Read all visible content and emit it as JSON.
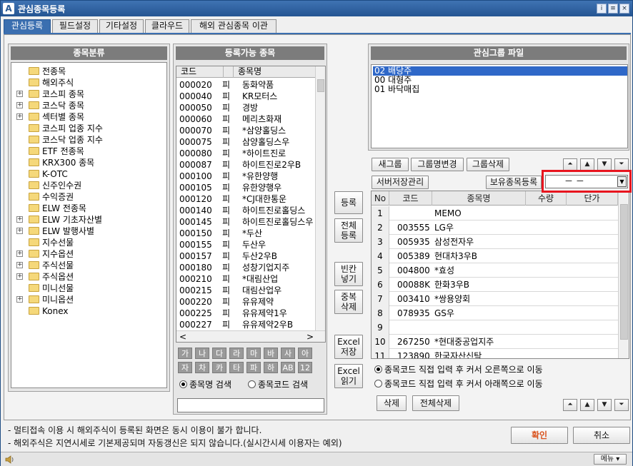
{
  "window": {
    "title": "관심종목등록",
    "logo": "A",
    "buttons": [
      "i",
      "≡",
      "×"
    ]
  },
  "tabs": [
    "관심등록",
    "필드설정",
    "기타설정",
    "클라우드",
    "해외 관심종목 이관"
  ],
  "left_panel": {
    "title": "종목분류",
    "tree": [
      {
        "label": "전종목",
        "expandable": false
      },
      {
        "label": "해외주식",
        "expandable": false
      },
      {
        "label": "코스피 종목",
        "expandable": true
      },
      {
        "label": "코스닥 종목",
        "expandable": true
      },
      {
        "label": "섹터별 종목",
        "expandable": true
      },
      {
        "label": "코스피 업종 지수",
        "expandable": false
      },
      {
        "label": "코스닥 업종 지수",
        "expandable": false
      },
      {
        "label": "ETF 전종목",
        "expandable": false
      },
      {
        "label": "KRX300 종목",
        "expandable": false
      },
      {
        "label": "K-OTC",
        "expandable": false
      },
      {
        "label": "신주인수권",
        "expandable": false
      },
      {
        "label": "수익증권",
        "expandable": false
      },
      {
        "label": "ELW 전종목",
        "expandable": false
      },
      {
        "label": "ELW 기초자산별",
        "expandable": true
      },
      {
        "label": "ELW 발행사별",
        "expandable": true
      },
      {
        "label": "지수선물",
        "expandable": false
      },
      {
        "label": "지수옵션",
        "expandable": true
      },
      {
        "label": "주식선물",
        "expandable": true
      },
      {
        "label": "주식옵션",
        "expandable": true
      },
      {
        "label": "미니선물",
        "expandable": false
      },
      {
        "label": "미니옵션",
        "expandable": true
      },
      {
        "label": "Konex",
        "expandable": false
      }
    ]
  },
  "middle_panel": {
    "title": "등록가능 종목",
    "columns": [
      "코드",
      "종목명"
    ],
    "rows": [
      {
        "code": "000020",
        "mk": "피",
        "name": "동화약품"
      },
      {
        "code": "000040",
        "mk": "피",
        "name": "KR모터스"
      },
      {
        "code": "000050",
        "mk": "피",
        "name": "경방"
      },
      {
        "code": "000060",
        "mk": "피",
        "name": "메리츠화재"
      },
      {
        "code": "000070",
        "mk": "피",
        "name": "*삼양홀딩스"
      },
      {
        "code": "000075",
        "mk": "피",
        "name": "삼양홀딩스우"
      },
      {
        "code": "000080",
        "mk": "피",
        "name": "*하이트진로"
      },
      {
        "code": "000087",
        "mk": "피",
        "name": "하이트진로2우B"
      },
      {
        "code": "000100",
        "mk": "피",
        "name": "*유한양행"
      },
      {
        "code": "000105",
        "mk": "피",
        "name": "유한양행우"
      },
      {
        "code": "000120",
        "mk": "피",
        "name": "*CJ대한통운"
      },
      {
        "code": "000140",
        "mk": "피",
        "name": "하이트진로홀딩스"
      },
      {
        "code": "000145",
        "mk": "피",
        "name": "하이트진로홀딩스우"
      },
      {
        "code": "000150",
        "mk": "피",
        "name": "*두산"
      },
      {
        "code": "000155",
        "mk": "피",
        "name": "두산우"
      },
      {
        "code": "000157",
        "mk": "피",
        "name": "두산2우B"
      },
      {
        "code": "000180",
        "mk": "피",
        "name": "성창기업지주"
      },
      {
        "code": "000210",
        "mk": "피",
        "name": "*대림산업"
      },
      {
        "code": "000215",
        "mk": "피",
        "name": "대림산업우"
      },
      {
        "code": "000220",
        "mk": "피",
        "name": "유유제약"
      },
      {
        "code": "000225",
        "mk": "피",
        "name": "유유제약1우"
      },
      {
        "code": "000227",
        "mk": "피",
        "name": "유유제약2우B"
      }
    ],
    "scroll_left": "<",
    "scroll_right": ">",
    "keys_row1": [
      "가",
      "나",
      "다",
      "라",
      "마",
      "바",
      "사",
      "아"
    ],
    "keys_row2": [
      "자",
      "차",
      "카",
      "타",
      "파",
      "하",
      "AB",
      "12"
    ],
    "search_by_name": "종목명 검색",
    "search_by_code": "종목코드 검색",
    "search_value": ""
  },
  "center_buttons": {
    "register": "등록",
    "register_all": [
      "전체",
      "등록"
    ],
    "insert_blank": [
      "빈칸",
      "넣기"
    ],
    "delete_dup": [
      "중복",
      "삭제"
    ],
    "excel_save": [
      "Excel",
      "저장"
    ],
    "excel_read": [
      "Excel",
      "읽기"
    ]
  },
  "right_panel": {
    "title": "관심그룹 파일",
    "groups": [
      "02 배당주",
      "00 대형주",
      "01 바닥매집"
    ],
    "new_group": "새그룹",
    "rename_group": "그룹명변경",
    "delete_group": "그룹삭제",
    "server_manage": "서버저장관리",
    "holdings_register": "보유종목등록",
    "holdings_select_value": "－ －",
    "grid_columns": [
      "No",
      "코드",
      "종목명",
      "수량",
      "단가"
    ],
    "grid_rows": [
      {
        "no": "1",
        "code": "",
        "name": "MEMO"
      },
      {
        "no": "2",
        "code": "003555",
        "name": "LG우"
      },
      {
        "no": "3",
        "code": "005935",
        "name": "삼성전자우"
      },
      {
        "no": "4",
        "code": "005389",
        "name": "현대차3우B"
      },
      {
        "no": "5",
        "code": "004800",
        "name": "*효성"
      },
      {
        "no": "6",
        "code": "00088K",
        "name": "한화3우B"
      },
      {
        "no": "7",
        "code": "003410",
        "name": "*쌍용양회"
      },
      {
        "no": "8",
        "code": "078935",
        "name": "GS우"
      },
      {
        "no": "9",
        "code": "",
        "name": ""
      },
      {
        "no": "10",
        "code": "267250",
        "name": "*현대중공업지주"
      },
      {
        "no": "11",
        "code": "123890",
        "name": "한국자산신탁"
      }
    ],
    "radio_right": "종목코드 직접 입력 후 커서 오른쪽으로 이동",
    "radio_down": "종목코드 직접 입력 후 커서 아래쪽으로 이동",
    "delete": "삭제",
    "delete_all": "전체삭제"
  },
  "notes": [
    "- 멀티접속 이용 시 해외주식이 등록된 화면은 동시 이용이 불가 합니다.",
    "- 해외주식은 지연시세로 기본제공되며 자동갱신은 되지 않습니다.(실시간시세 이용자는 예외)"
  ],
  "confirm": "확인",
  "cancel": "취소",
  "status": {
    "menu": "메뉴"
  },
  "colors": {
    "title_bar": "#2a5a95",
    "tab_active": "#3b6fb0",
    "confirm_text": "#d9531e",
    "highlight_box": "#e8141e",
    "selection": "#2f68c8"
  },
  "icons": {
    "speaker": "speaker-icon",
    "folder": "folder-icon"
  }
}
